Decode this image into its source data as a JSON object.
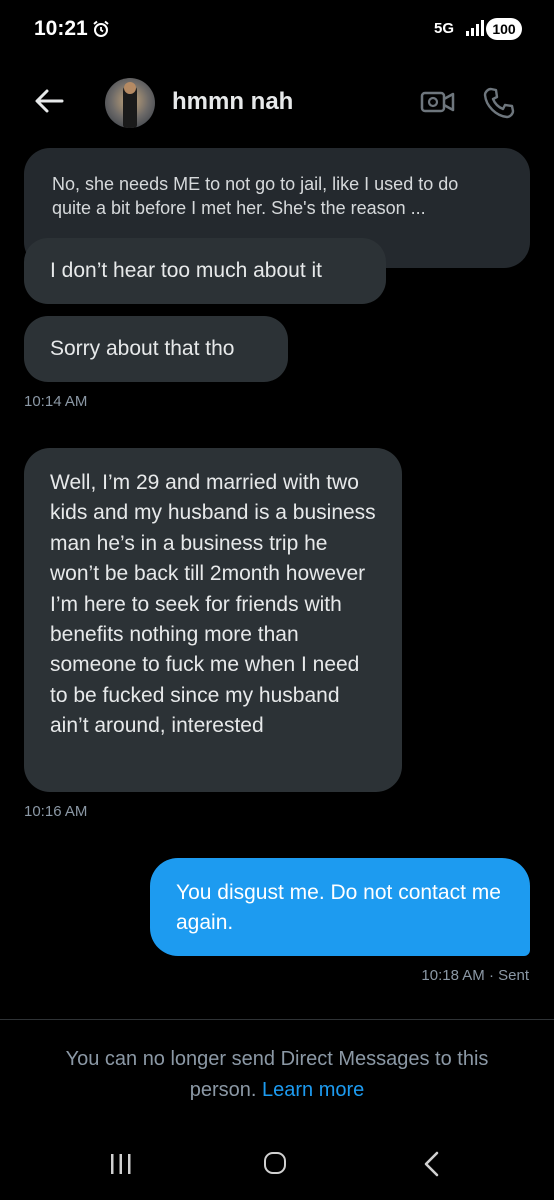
{
  "status": {
    "time": "10:21",
    "network": "5G",
    "battery": "100"
  },
  "header": {
    "name": "hmmn nah"
  },
  "messages": [
    {
      "from": "them",
      "text": "No, she needs ME to not go to jail, like I used to do quite a bit before I met her. She's the reason ..."
    },
    {
      "from": "them",
      "text": "I don’t hear too much about it"
    },
    {
      "from": "them",
      "text": "Sorry about that tho"
    },
    {
      "from": "them",
      "text": "Well, I’m 29 and married with two kids and my husband is a business man he’s in a business trip he won’t be back till 2month however I’m here to seek for friends with benefits nothing more than someone to fuck me when I need to be fucked since my husband ain’t around, interested"
    },
    {
      "from": "me",
      "text": "You disgust me. Do not contact me again."
    }
  ],
  "timestamps": {
    "t1": "10:14 AM",
    "t2": "10:16 AM",
    "t3": "10:18 AM · Sent"
  },
  "notice": {
    "text": "You can no longer send Direct Messages to this person.",
    "link": "Learn more"
  },
  "colors": {
    "accent": "#1d9bf0",
    "bubble_received": "#2c3236",
    "background": "#000000"
  }
}
